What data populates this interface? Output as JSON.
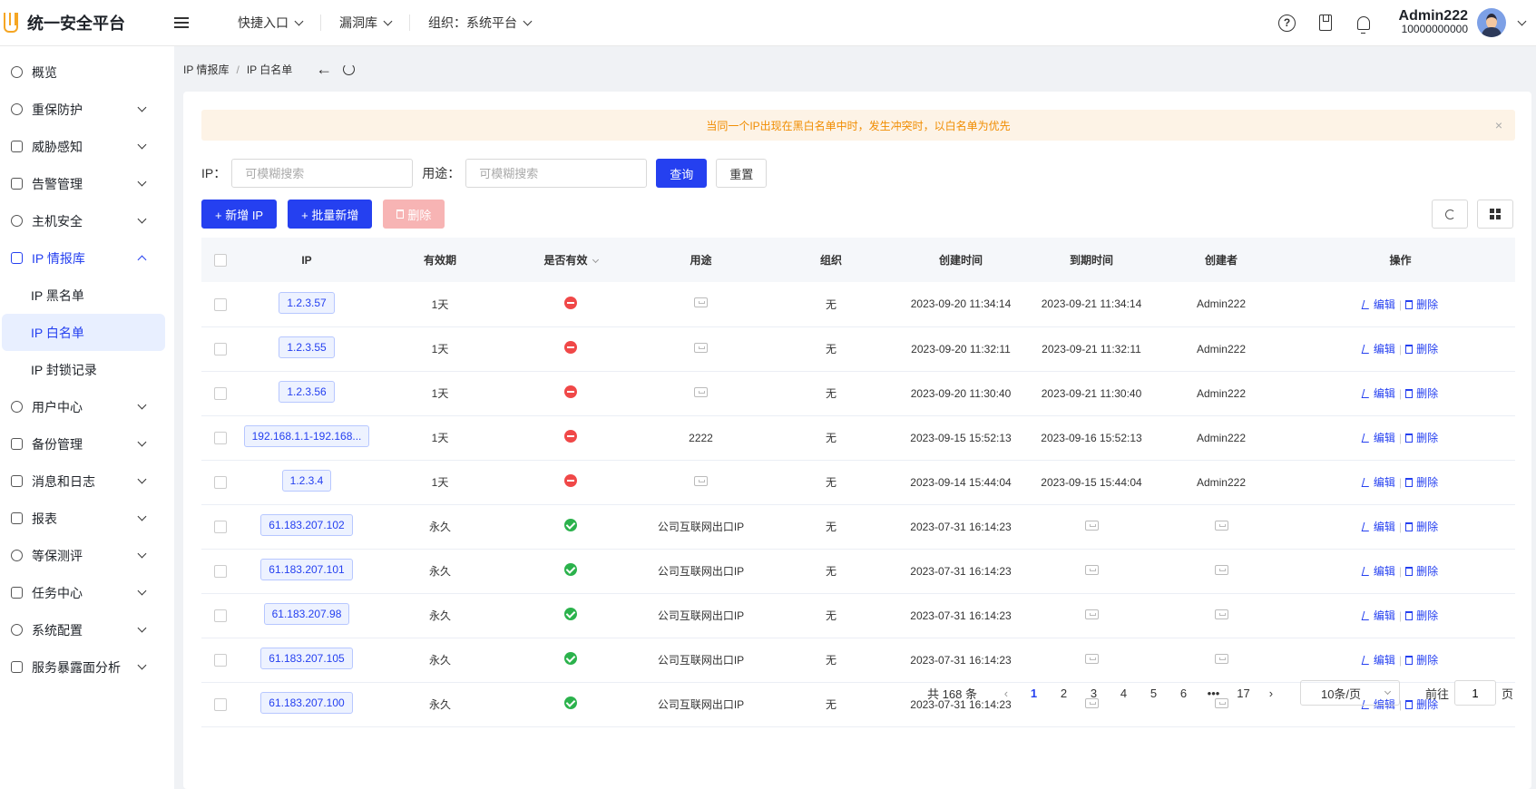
{
  "app": {
    "title": "统一安全平台"
  },
  "header": {
    "nav": [
      {
        "label": "快捷入口"
      },
      {
        "label": "漏洞库"
      },
      {
        "label": "组织：系统平台"
      }
    ],
    "user": {
      "name": "Admin222",
      "id": "10000000000"
    }
  },
  "sidebar": {
    "items": [
      {
        "label": "概览",
        "icon": "dashboard-icon"
      },
      {
        "label": "重保防护",
        "icon": "fire-icon"
      },
      {
        "label": "威胁感知",
        "icon": "server-icon"
      },
      {
        "label": "告警管理",
        "icon": "warning-icon"
      },
      {
        "label": "主机安全",
        "icon": "eye-icon"
      },
      {
        "label": "IP 情报库",
        "icon": "ip-icon"
      },
      {
        "label": "用户中心",
        "icon": "users-icon"
      },
      {
        "label": "备份管理",
        "icon": "backup-icon"
      },
      {
        "label": "消息和日志",
        "icon": "calendar-icon"
      },
      {
        "label": "报表",
        "icon": "report-icon"
      },
      {
        "label": "等保测评",
        "icon": "gauge-icon"
      },
      {
        "label": "任务中心",
        "icon": "clipboard-icon"
      },
      {
        "label": "系统配置",
        "icon": "gear-icon"
      },
      {
        "label": "服务暴露面分析",
        "icon": "building-icon"
      }
    ],
    "sub": [
      {
        "label": "IP 黑名单"
      },
      {
        "label": "IP 白名单"
      },
      {
        "label": "IP 封锁记录"
      }
    ]
  },
  "breadcrumb": {
    "parent": "IP 情报库",
    "sep": "/",
    "current": "IP 白名单"
  },
  "alert": {
    "text": "当同一个IP出现在黑白名单中时，发生冲突时，以白名单为优先",
    "close": "×"
  },
  "filters": {
    "ip_label": "IP：",
    "ip_placeholder": "可模糊搜索",
    "use_label": "用途：",
    "use_placeholder": "可模糊搜索",
    "search": "查询",
    "reset": "重置"
  },
  "toolbar": {
    "add": "+ 新增 IP",
    "batch_add": "+ 批量新增",
    "delete": "删除"
  },
  "table": {
    "columns": [
      "IP",
      "有效期",
      "是否有效",
      "用途",
      "组织",
      "创建时间",
      "到期时间",
      "创建者",
      "操作"
    ],
    "edit_label": "编辑",
    "delete_label": "删除",
    "rows": [
      {
        "ip": "1.2.3.57",
        "validity": "1天",
        "valid": false,
        "use": "",
        "org": "无",
        "created": "2023-09-20 11:34:14",
        "expires": "2023-09-21 11:34:14",
        "creator": "Admin222"
      },
      {
        "ip": "1.2.3.55",
        "validity": "1天",
        "valid": false,
        "use": "",
        "org": "无",
        "created": "2023-09-20 11:32:11",
        "expires": "2023-09-21 11:32:11",
        "creator": "Admin222"
      },
      {
        "ip": "1.2.3.56",
        "validity": "1天",
        "valid": false,
        "use": "",
        "org": "无",
        "created": "2023-09-20 11:30:40",
        "expires": "2023-09-21 11:30:40",
        "creator": "Admin222"
      },
      {
        "ip": "192.168.1.1-192.168...",
        "validity": "1天",
        "valid": false,
        "use": "2222",
        "org": "无",
        "created": "2023-09-15 15:52:13",
        "expires": "2023-09-16 15:52:13",
        "creator": "Admin222"
      },
      {
        "ip": "1.2.3.4",
        "validity": "1天",
        "valid": false,
        "use": "",
        "org": "无",
        "created": "2023-09-14 15:44:04",
        "expires": "2023-09-15 15:44:04",
        "creator": "Admin222"
      },
      {
        "ip": "61.183.207.102",
        "validity": "永久",
        "valid": true,
        "use": "公司互联网出口IP",
        "org": "无",
        "created": "2023-07-31 16:14:23",
        "expires": "",
        "creator": ""
      },
      {
        "ip": "61.183.207.101",
        "validity": "永久",
        "valid": true,
        "use": "公司互联网出口IP",
        "org": "无",
        "created": "2023-07-31 16:14:23",
        "expires": "",
        "creator": ""
      },
      {
        "ip": "61.183.207.98",
        "validity": "永久",
        "valid": true,
        "use": "公司互联网出口IP",
        "org": "无",
        "created": "2023-07-31 16:14:23",
        "expires": "",
        "creator": ""
      },
      {
        "ip": "61.183.207.105",
        "validity": "永久",
        "valid": true,
        "use": "公司互联网出口IP",
        "org": "无",
        "created": "2023-07-31 16:14:23",
        "expires": "",
        "creator": ""
      },
      {
        "ip": "61.183.207.100",
        "validity": "永久",
        "valid": true,
        "use": "公司互联网出口IP",
        "org": "无",
        "created": "2023-07-31 16:14:23",
        "expires": "",
        "creator": ""
      }
    ]
  },
  "pagination": {
    "total": "共 168 条",
    "pages": [
      "1",
      "2",
      "3",
      "4",
      "5",
      "6",
      "•••",
      "17"
    ],
    "current": "1",
    "page_size": "10条/页",
    "jump_prefix": "前往",
    "jump_value": "1",
    "jump_suffix": "页"
  },
  "colors": {
    "primary": "#2540f0",
    "alert_bg": "#fdf3e6",
    "alert_text": "#f08c00",
    "valid": "#2bb24c",
    "invalid": "#f04848"
  }
}
